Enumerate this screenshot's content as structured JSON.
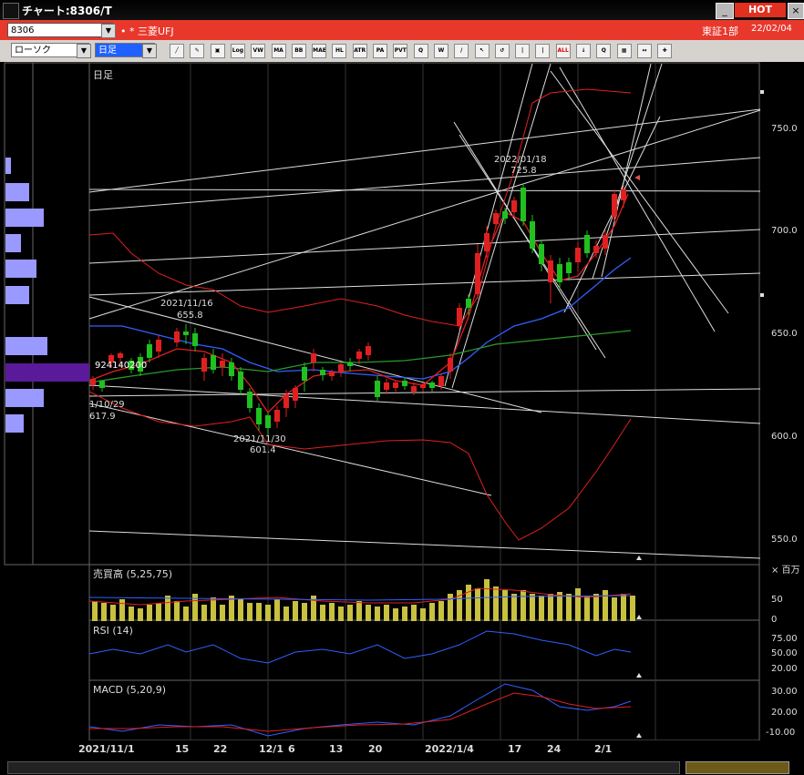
{
  "window": {
    "title": "チャート:8306/T",
    "hot_label": "HOT",
    "min": "_",
    "max": "□",
    "close": "×"
  },
  "symbol_bar": {
    "code": "8306",
    "name": "• * 三菱UFJ",
    "market": "東証1部",
    "date": "22/02/04"
  },
  "toolbar": {
    "chart_type": "ローソク",
    "period": "日足",
    "buttons": [
      "line-draw",
      "brush",
      "palette",
      "Log",
      "VWAP",
      "MA",
      "BB",
      "MAE",
      "HL",
      "ATR",
      "PARA",
      "PVT",
      "zoom",
      "window",
      "pencil",
      "cursor",
      "redo",
      "bar-a",
      "bar-b",
      "ALL",
      "download",
      "search",
      "layout",
      "arrows",
      "pin"
    ]
  },
  "price_panel": {
    "label": "日足",
    "axis": [
      "750.0",
      "700.0",
      "650.0",
      "600.0",
      "550.0"
    ],
    "annotations": {
      "high1_date": "2021/11/16",
      "high1_val": "655.8",
      "low1_date": "2021/11/30",
      "low1_val": "601.4",
      "high2_date": "2022/01/18",
      "high2_val": "725.8",
      "left_date": "1/10/29",
      "left_val": "617.9",
      "volume_tag": "924140200"
    }
  },
  "volume_panel": {
    "label": "売買高 (5,25,75)",
    "unit": "× 百万",
    "axis": [
      "50",
      "0"
    ]
  },
  "rsi_panel": {
    "label": "RSI (14)",
    "axis": [
      "75.00",
      "50.00",
      "20.00"
    ]
  },
  "macd_panel": {
    "label": "MACD (5,20,9)",
    "axis": [
      "30.00",
      "20.00",
      "-10.00"
    ]
  },
  "date_axis": [
    "2021/11/1",
    "15",
    "22",
    "12/1",
    "6",
    "13",
    "20",
    "2022/1/4",
    "17",
    "24",
    "2/1"
  ],
  "colors": {
    "up": "#e02020",
    "down": "#20c020",
    "volume": "#c8c040",
    "ma_blue": "#3060ff",
    "ma_green": "#2a9a2a",
    "highlight": "#5a1a9a"
  }
}
